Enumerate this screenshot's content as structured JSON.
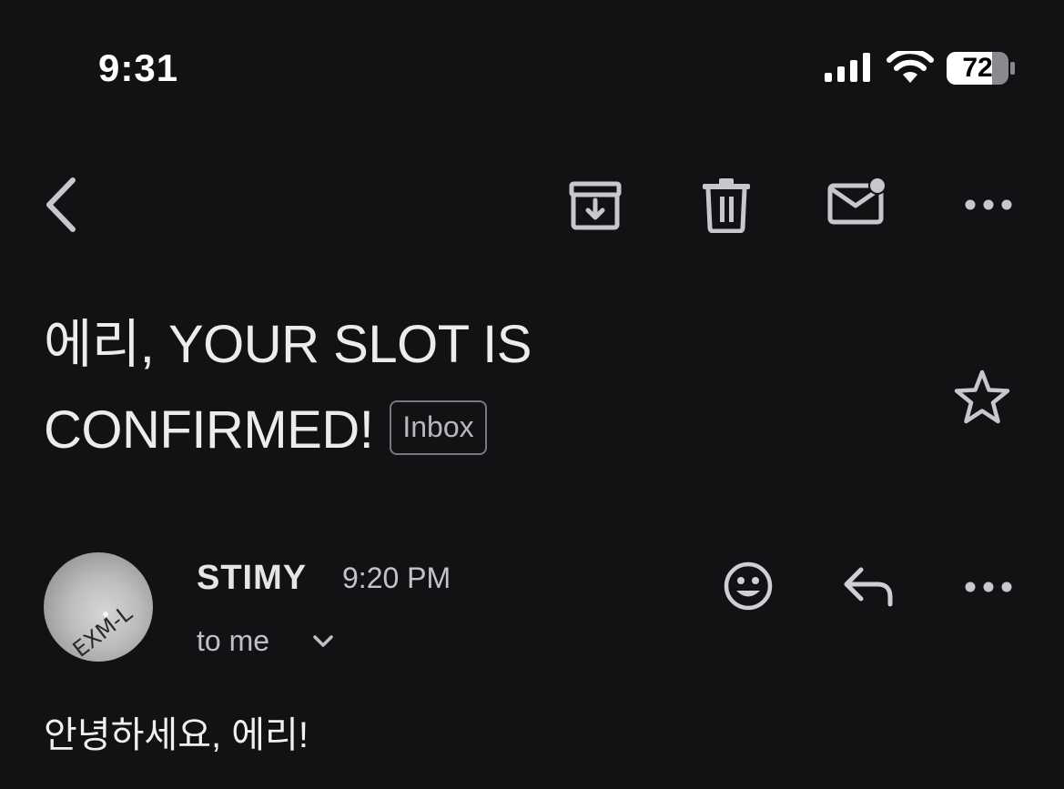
{
  "status_bar": {
    "time": "9:31",
    "battery_level": "72",
    "icons": [
      "cellular-signal-icon",
      "wifi-icon",
      "battery-icon"
    ]
  },
  "toolbar": {
    "icons": [
      "back-chevron-icon",
      "archive-icon",
      "trash-icon",
      "mark-unread-icon",
      "more-options-icon"
    ]
  },
  "message": {
    "subject_line1": "에리, YOUR SLOT IS",
    "subject_line2": "CONFIRMED!",
    "label": "Inbox",
    "sender": "STIMY",
    "time": "9:20 PM",
    "recipient": "to me",
    "body_greeting": "안녕하세요, 에리!",
    "avatar_text": "EXM-L"
  },
  "colors": {
    "background": "#121214",
    "text_primary": "#ececee",
    "text_secondary": "#c0c0c4",
    "icon": "#c8c8cc",
    "badge_border": "#77777c"
  }
}
